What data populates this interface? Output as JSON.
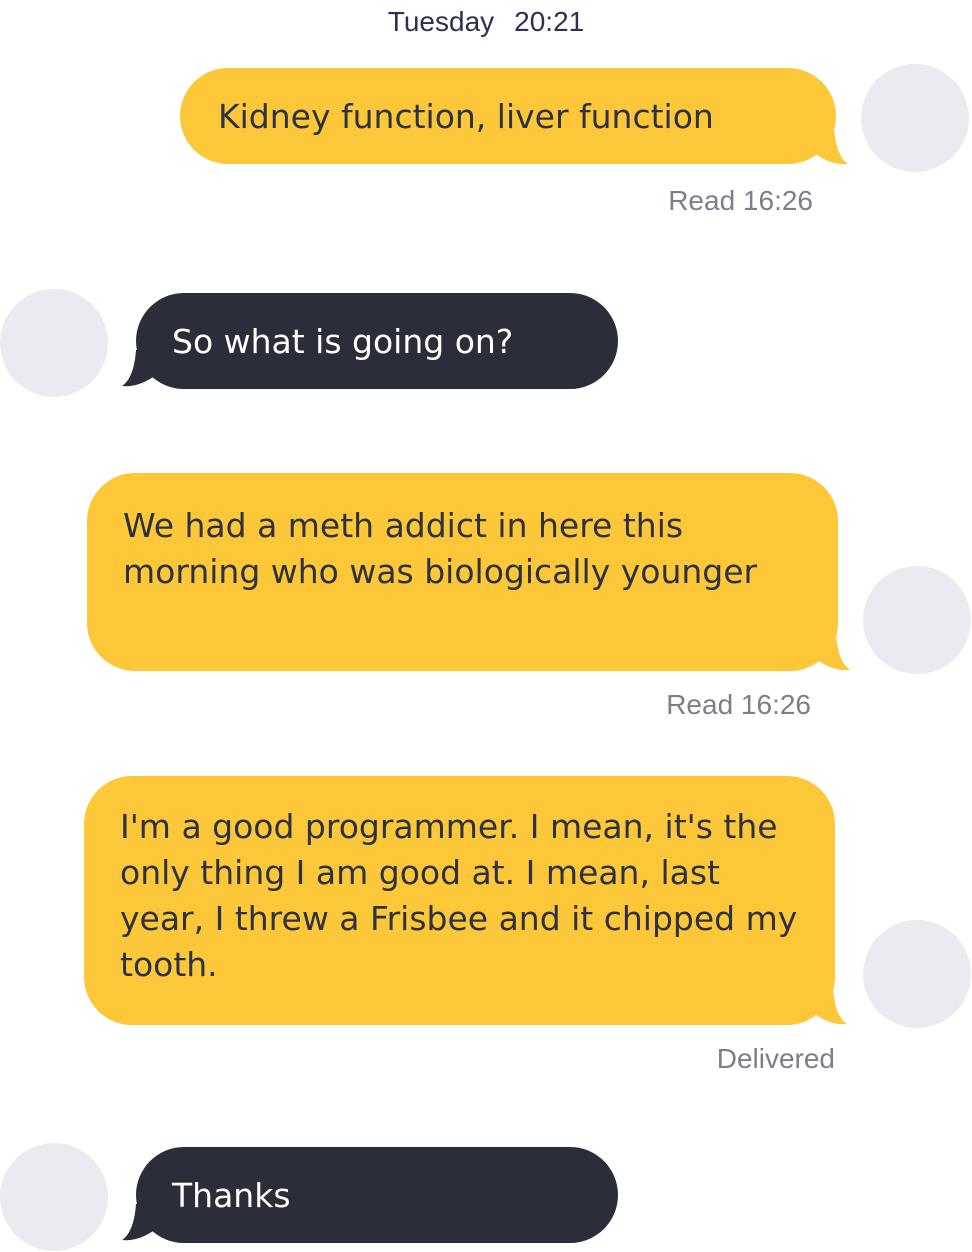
{
  "header": {
    "day": "Tuesday",
    "time": "20:21"
  },
  "colors": {
    "sent_bubble": "#fcc83a",
    "received_bubble": "#2b2d38",
    "avatar": "#e9ebf1",
    "receipt_text": "#7a7f8a"
  },
  "messages": [
    {
      "direction": "sent",
      "text": "Kidney function, liver function",
      "receipt": "Read 16:26"
    },
    {
      "direction": "received",
      "text": "So what is going on?"
    },
    {
      "direction": "sent",
      "text": "We had a meth addict in here this morning who was biologically younger",
      "receipt": "Read 16:26"
    },
    {
      "direction": "sent",
      "text": "I'm a good programmer. I mean, it's the only thing I am good at. I mean, last year, I threw a Frisbee and it chipped my tooth.",
      "receipt": "Delivered"
    },
    {
      "direction": "received",
      "text": "Thanks"
    }
  ]
}
